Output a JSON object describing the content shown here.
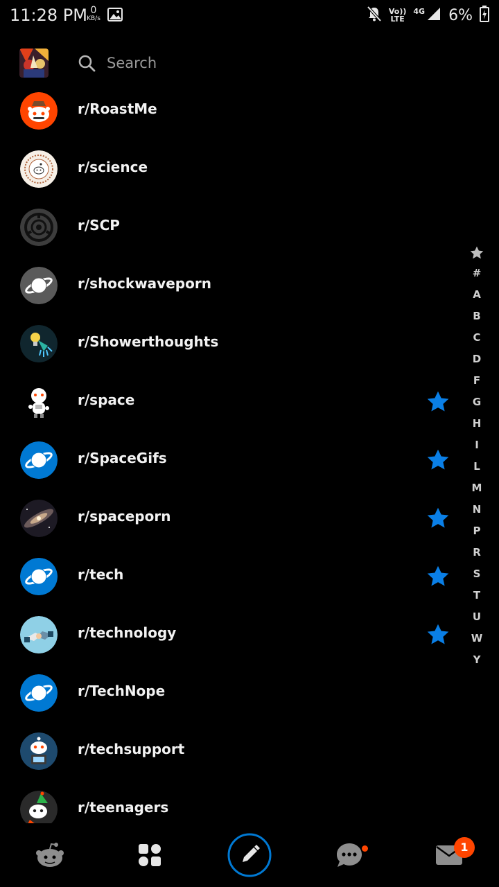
{
  "status_bar": {
    "time": "11:28 PM",
    "net_speed": "0",
    "net_unit": "KB/s",
    "volte_top": "Vo))",
    "volte_bottom": "LTE",
    "network": "4G",
    "battery": "6%"
  },
  "search": {
    "placeholder": "Search"
  },
  "subreddits": [
    {
      "name": "r/RoastMe",
      "favorite": false,
      "icon": "roastme-icon"
    },
    {
      "name": "r/science",
      "favorite": false,
      "icon": "science-icon"
    },
    {
      "name": "r/SCP",
      "favorite": false,
      "icon": "scp-icon"
    },
    {
      "name": "r/shockwaveporn",
      "favorite": false,
      "icon": "planet-icon"
    },
    {
      "name": "r/Showerthoughts",
      "favorite": false,
      "icon": "showerthoughts-icon"
    },
    {
      "name": "r/space",
      "favorite": true,
      "icon": "space-icon"
    },
    {
      "name": "r/SpaceGifs",
      "favorite": true,
      "icon": "planet-icon"
    },
    {
      "name": "r/spaceporn",
      "favorite": true,
      "icon": "galaxy-icon"
    },
    {
      "name": "r/tech",
      "favorite": true,
      "icon": "planet-icon"
    },
    {
      "name": "r/technology",
      "favorite": true,
      "icon": "technology-icon"
    },
    {
      "name": "r/TechNope",
      "favorite": false,
      "icon": "planet-icon"
    },
    {
      "name": "r/techsupport",
      "favorite": false,
      "icon": "techsupport-icon"
    },
    {
      "name": "r/teenagers",
      "favorite": false,
      "icon": "teenagers-icon"
    }
  ],
  "alphabet_index": [
    "#",
    "A",
    "B",
    "C",
    "D",
    "F",
    "G",
    "H",
    "I",
    "L",
    "M",
    "N",
    "P",
    "R",
    "S",
    "T",
    "U",
    "W",
    "Y"
  ],
  "bottom_nav": {
    "items": [
      "home-icon",
      "communities-icon",
      "create-post-icon",
      "chat-icon",
      "inbox-icon"
    ],
    "inbox_badge": "1"
  },
  "colors": {
    "background": "#000000",
    "accent_blue": "#0079d3",
    "favorite_star": "#0a7fe6",
    "notification": "#ff4500"
  }
}
